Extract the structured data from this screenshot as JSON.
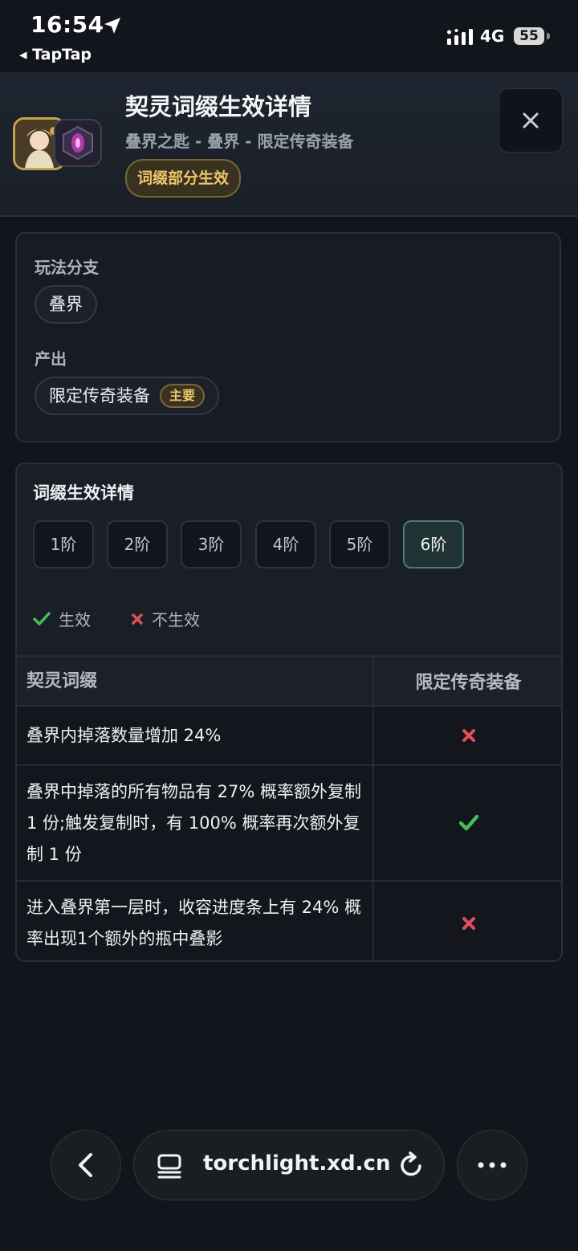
{
  "status_bar": {
    "time": "16:54",
    "back_app": "◂ TapTap",
    "network": "4G",
    "battery": "55"
  },
  "header": {
    "title": "契灵词缀生效详情",
    "subtitle": "叠界之匙 - 叠界 - 限定传奇装备",
    "badge": "词缀部分生效",
    "close_icon": "close-icon"
  },
  "overview": {
    "branch_label": "玩法分支",
    "branch_value": "叠界",
    "output_label": "产出",
    "output_value": "限定传奇装备",
    "output_tag": "主要"
  },
  "details": {
    "title": "词缀生效详情",
    "tiers": [
      "1阶",
      "2阶",
      "3阶",
      "4阶",
      "5阶",
      "6阶"
    ],
    "active_tier": "6阶",
    "legend": {
      "effective": "生效",
      "not_effective": "不生效"
    },
    "table": {
      "headers": [
        "契灵词缀",
        "限定传奇装备"
      ],
      "rows": [
        {
          "affix": "叠界内掉落数量增加 24%",
          "status": "not_effective"
        },
        {
          "affix": "叠界中掉落的所有物品有 27% 概率额外复制 1 份;触发复制时，有 100% 概率再次额外复制 1 份",
          "status": "effective"
        },
        {
          "affix": "进入叠界第一层时，收容进度条上有 24% 概率出现1个额外的瓶中叠影",
          "status": "not_effective"
        }
      ]
    }
  },
  "browser": {
    "url": "torchlight.xd.cn"
  },
  "colors": {
    "background": "#12151b",
    "accent_gold": "#f0c76a",
    "check_green": "#3fbf5c",
    "cross_red": "#e0505a",
    "active_tier": "#4d7a79"
  }
}
